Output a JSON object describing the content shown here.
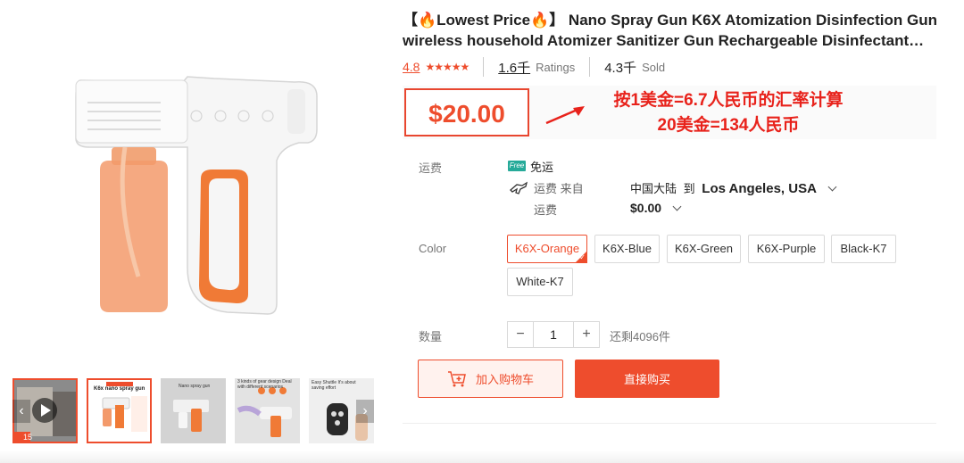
{
  "product": {
    "title_line1": "【🔥Lowest Price🔥】 Nano Spray Gun K6X Atomization Disinfection Gun",
    "title_line2": "wireless household Atomizer Sanitizer Gun Rechargeable Disinfectant…",
    "rating": "4.8",
    "stars": "★★★★★",
    "ratings_count": "1.6千",
    "ratings_label": "Ratings",
    "sold_count": "4.3千",
    "sold_label": "Sold",
    "price": "$20.00",
    "note_line1": "按1美金=6.7人民币的汇率计算",
    "note_line2": "20美金=134人民币"
  },
  "shipping": {
    "label": "运费",
    "free_badge": "Free",
    "free_text": "免运",
    "from_label": "运费 来自",
    "cost_label": "运费",
    "from": "中国大陆",
    "to_word": "到",
    "destination": "Los Angeles, USA",
    "cost": "$0.00"
  },
  "variants": {
    "label": "Color",
    "options": [
      "K6X-Orange",
      "K6X-Blue",
      "K6X-Green",
      "K6X-Purple",
      "Black-K7",
      "White-K7"
    ],
    "selected": "K6X-Orange"
  },
  "quantity": {
    "label": "数量",
    "minus": "−",
    "value": "1",
    "plus": "+",
    "stock": "还剩4096件"
  },
  "actions": {
    "add_to_cart": "加入购物车",
    "buy_now": "直接购买"
  },
  "gallery": {
    "thumb2_title": "K6x nano spray gun",
    "thumb3_title": "Nano spray gun",
    "thumb4_title": "3 kinds of gear design Deal with different scenarios",
    "thumb5_title": "Easy Shuttle It's about saving effort",
    "video_badge": "15",
    "prev_arrow": "‹",
    "next_arrow": "›"
  },
  "colors": {
    "accent": "#ee4d2d",
    "note": "#e8221b",
    "free_ship": "#26aa99"
  }
}
